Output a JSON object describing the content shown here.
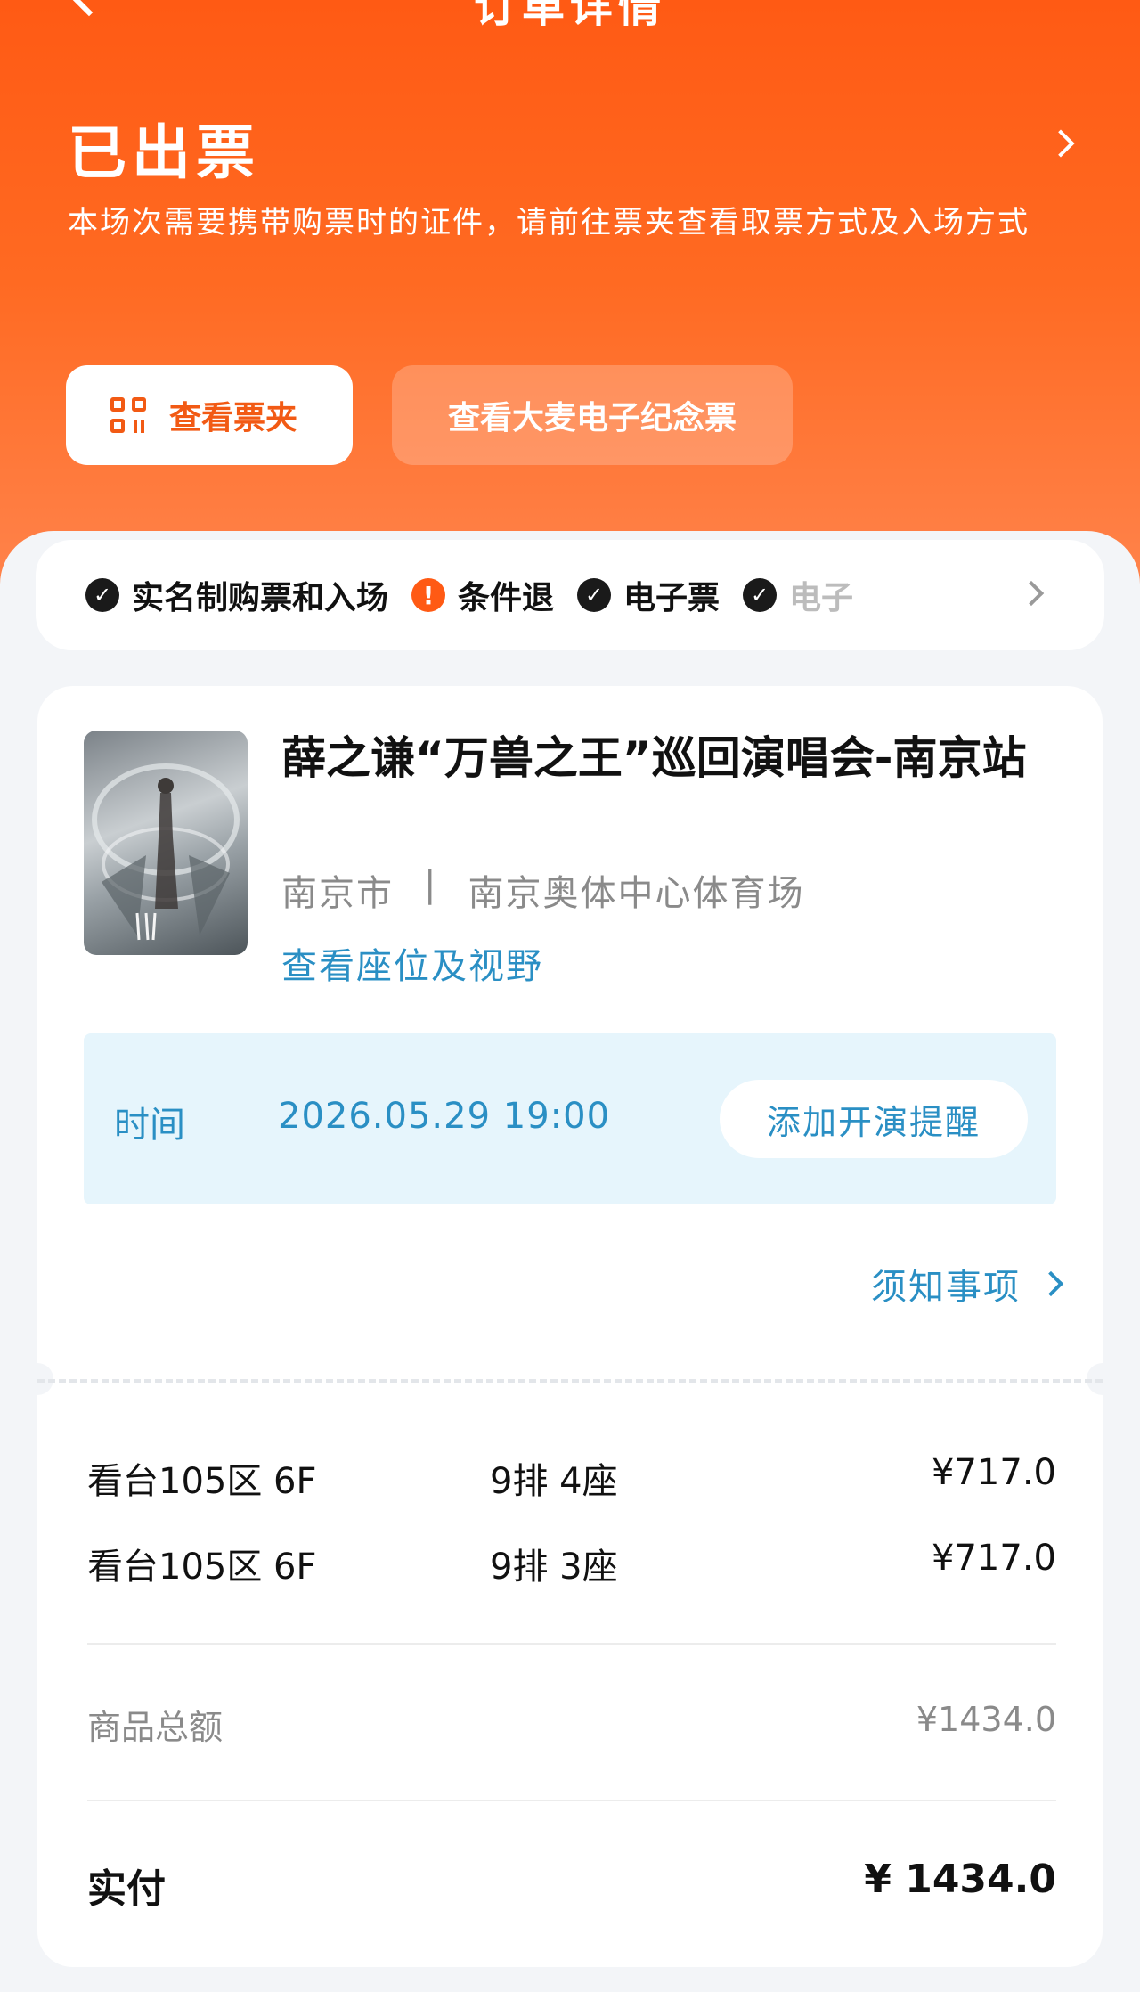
{
  "nav": {
    "title": "订单详情"
  },
  "status": {
    "title": "已出票",
    "description": "本场次需要携带购票时的证件，请前往票夹查看取票方式及入场方式",
    "buttons": {
      "wallet": "查看票夹",
      "souvenir": "查看大麦电子纪念票"
    }
  },
  "tags": [
    {
      "label": "实名制购票和入场",
      "icon": "check-icon"
    },
    {
      "label": "条件退",
      "icon": "warning-icon"
    },
    {
      "label": "电子票",
      "icon": "check-icon"
    },
    {
      "label": "电子",
      "icon": "check-icon"
    }
  ],
  "event": {
    "title": "薛之谦“万兽之王”巡回演唱会-南京站",
    "city": "南京市",
    "separator": "|",
    "venue": "南京奥体中心体育场",
    "seat_view_link": "查看座位及视野",
    "time_label": "时间",
    "time_value": "2026.05.29 19:00",
    "reminder_button": "添加开演提醒",
    "notice_link": "须知事项"
  },
  "tickets": [
    {
      "area": "看台105区 6F",
      "seat": "9排 4座",
      "price": "¥717.0"
    },
    {
      "area": "看台105区 6F",
      "seat": "9排 3座",
      "price": "¥717.0"
    }
  ],
  "summary": {
    "subtotal_label": "商品总额",
    "subtotal_value": "¥1434.0",
    "paid_label": "实付",
    "paid_value": "¥ 1434.0"
  },
  "colors": {
    "brand_orange": "#ff5a14",
    "link_blue": "#2a8fc4",
    "time_box_bg": "#e6f5fc"
  }
}
